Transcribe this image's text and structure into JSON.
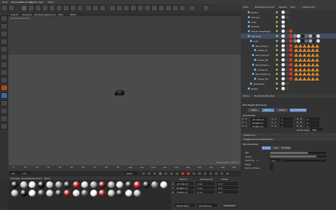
{
  "menu": {
    "items": [
      "Datei",
      "Bearbeiten",
      "Darstellung",
      "Objekte",
      "Tags",
      "Textur"
    ]
  },
  "viewport": {
    "menu": [
      "Ansicht",
      "Kameras",
      "Darstellung",
      "Optionen",
      "Filter",
      "Tafeln"
    ],
    "label": "Zentralperspektive",
    "status": "Rasterweite: 1000 cm"
  },
  "timeline": {
    "ticks": [
      "0",
      "10",
      "20",
      "30",
      "40",
      "50",
      "60",
      "70",
      "80",
      "90",
      "100",
      "110",
      "120",
      "130",
      "140",
      "150",
      "160",
      "170",
      "180",
      "190"
    ],
    "current": "0 B",
    "start": "0 B",
    "end": "200 B"
  },
  "materials": {
    "menu": [
      "Erzeugen",
      "Bearbeiten",
      "Funktion",
      "Textur"
    ],
    "colors": [
      "#1a1a1a",
      "#bdbdbd",
      "#f0f0f0",
      "#101010",
      "#c8c8c8",
      "#8a8a8a",
      "#2a2a2a",
      "#b51e1e",
      "#d8d8d8",
      "#9a9a9a",
      "#7a0e0e",
      "#a4a4a4",
      "#e0e0e0",
      "#303030",
      "#d02020",
      "#222222",
      "#808080",
      "#eeeeee",
      "#bbbbbb",
      "#151515",
      "#f5f5f5",
      "#444444",
      "#cfcfcf",
      "#353535",
      "#9c1a1a",
      "#e4e4e4",
      "#5a5a5a",
      "#ffffff",
      "#a02020",
      "#c0c0c0",
      "#2e2e2e",
      "#f2f2f2",
      "#bcbcbc"
    ]
  },
  "coords": {
    "headers": [
      "Position",
      "Abmessung",
      "Winkel"
    ],
    "rows": [
      {
        "axis": "X",
        "pos": "-37.749 cm",
        "size": "0 cm",
        "angle": "H 0 °"
      },
      {
        "axis": "Y",
        "pos": "99.828 cm",
        "size": "0 cm",
        "angle": "P 0 °"
      },
      {
        "axis": "Z",
        "pos": "79.863 cm",
        "size": "0 cm",
        "angle": "B 0 °"
      }
    ],
    "mode": "Objekt (Rel)",
    "size_mode": "Abmessung",
    "apply": "Anwenden"
  },
  "object_manager": {
    "menu": [
      "Datei",
      "Bearbeiten",
      "Ansicht",
      "Objekte",
      "Tags",
      "Lesezeichen"
    ],
    "objects": [
      {
        "name": "Boden",
        "indent": 0,
        "tags": 2,
        "warn": 0
      },
      {
        "name": "Himmel",
        "indent": 0,
        "tags": 2,
        "warn": 0
      },
      {
        "name": "Licht",
        "indent": 0,
        "tags": 1,
        "warn": 0
      },
      {
        "name": "Kamera",
        "indent": 0,
        "tags": 1,
        "warn": 0
      },
      {
        "name": "Physik Hinzufügen",
        "indent": 0,
        "tags": 3,
        "warn": 0
      },
      {
        "name": "Fahrzeug",
        "indent": 0,
        "tags": 10,
        "warn": 0
      },
      {
        "name": "Auto",
        "indent": 1,
        "tags": 10,
        "warn": 0
      },
      {
        "name": "Rad_Vorne_L",
        "indent": 2,
        "tags": 3,
        "warn": 6
      },
      {
        "name": "Achse_VL",
        "indent": 3,
        "tags": 3,
        "warn": 6
      },
      {
        "name": "Rad_Vorne_R",
        "indent": 2,
        "tags": 3,
        "warn": 6
      },
      {
        "name": "Achse_VR",
        "indent": 3,
        "tags": 3,
        "warn": 6
      },
      {
        "name": "Rad_Hinten_L",
        "indent": 2,
        "tags": 3,
        "warn": 6
      },
      {
        "name": "Achse_HL",
        "indent": 3,
        "tags": 3,
        "warn": 6
      },
      {
        "name": "Rad_Hinten_R",
        "indent": 2,
        "tags": 3,
        "warn": 6
      },
      {
        "name": "Achse_HR",
        "indent": 3,
        "tags": 3,
        "warn": 6
      },
      {
        "name": "Karosserie",
        "indent": 1,
        "tags": 2,
        "warn": 0
      },
      {
        "name": "Boden",
        "indent": 0,
        "tags": 2,
        "warn": 0
      }
    ]
  },
  "attributes": {
    "menu": [
      "Modus",
      "Bearbeiten",
      "Benutzer"
    ],
    "title": "Null-Objekt [Fahrzeug]",
    "tabs": [
      "Basis",
      "Koord.",
      "Objekt",
      "Benutzerdaten"
    ],
    "section": "Koordinaten",
    "coord_rows": [
      {
        "label": "P . X",
        "val": "-37.749 cm",
        "label2": "S . X",
        "val2": "1",
        "label3": "R . H",
        "val3": "0 °"
      },
      {
        "label": "P . Y",
        "val": "99.828 cm",
        "label2": "S . Y",
        "val2": "1",
        "label3": "R . P",
        "val3": "0 °"
      },
      {
        "label": "P . Z",
        "val": "79.863 cm",
        "label2": "S . Z",
        "val2": "1",
        "label3": "R . B",
        "val3": "0 °"
      }
    ],
    "order": "Reihenfolge",
    "order_val": "HPB",
    "collapsed": [
      "Quaternion",
      "Eingefrorene Transformation"
    ],
    "user_section": "Benutzerdaten",
    "subtabs": [
      "Gruppe",
      "Alle",
      "Sonstige"
    ],
    "user_rows": [
      {
        "label": "gas",
        "val": ""
      },
      {
        "label": "speed",
        "val": ""
      },
      {
        "label": "Lenkung . . L",
        "val": "0 %"
      },
      {
        "label": "Reset",
        "val": ""
      },
      {
        "label": "Rad in Achsen",
        "val": ""
      }
    ],
    "fps": "30"
  },
  "accent": "#5a83b6",
  "warn_color": "#e08a2a"
}
